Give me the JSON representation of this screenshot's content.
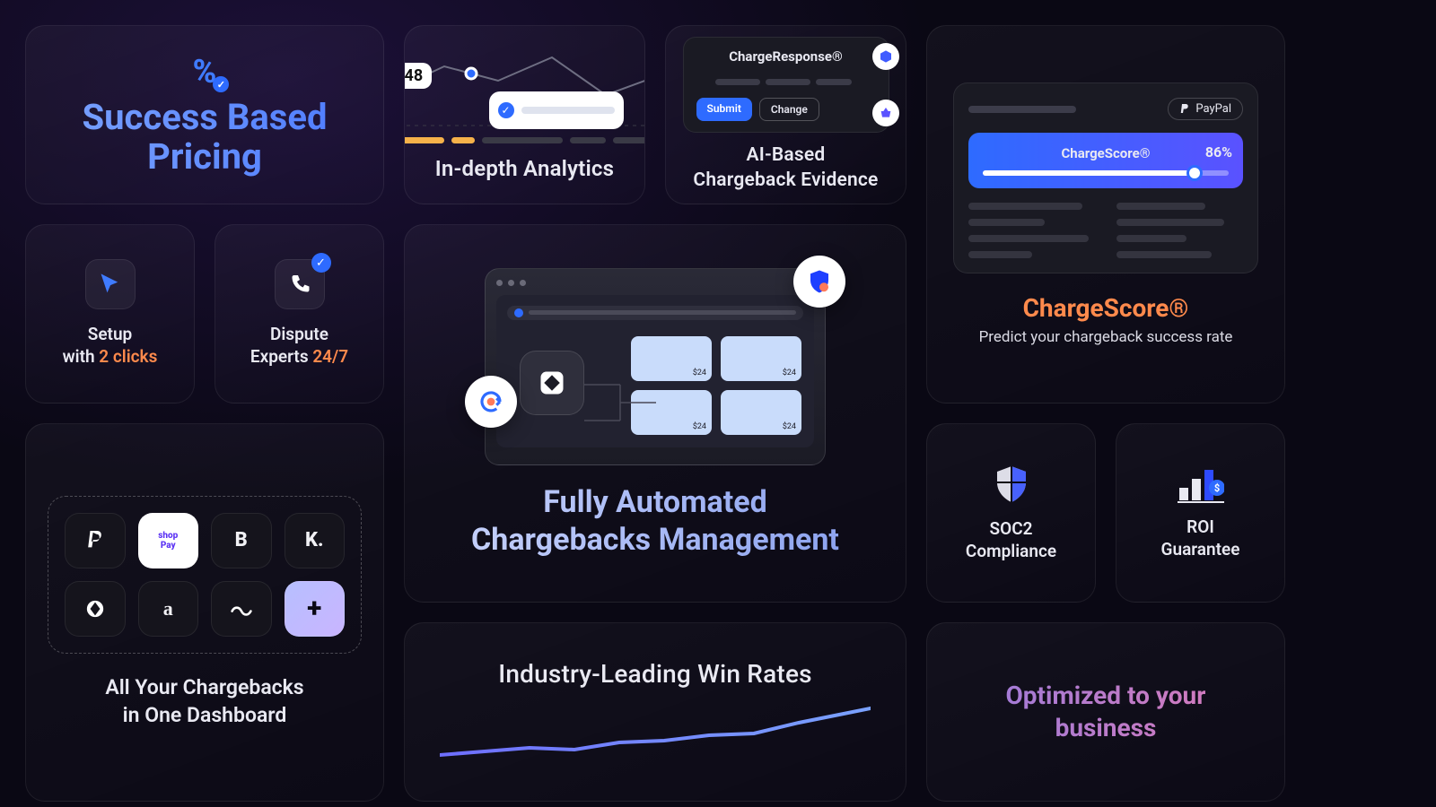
{
  "pricing": {
    "heading": "Success Based Pricing"
  },
  "setup": {
    "line1": "Setup",
    "line2_prefix": "with ",
    "line2_accent": "2 clicks"
  },
  "experts": {
    "line1": "Dispute",
    "line2_prefix": "Experts ",
    "line2_accent": "24/7"
  },
  "integrations": {
    "tiles": [
      "P",
      "shop",
      "B",
      "K.",
      "◔",
      "a",
      "⇄",
      "+"
    ],
    "caption_l1": "All Your Chargebacks",
    "caption_l2": "in One Dashboard"
  },
  "analytics": {
    "badge": "48",
    "title": "In-depth Analytics"
  },
  "evidence": {
    "panel_title": "ChargeResponse®",
    "submit": "Submit",
    "change": "Change",
    "title_l1": "AI-Based",
    "title_l2": "Chargeback Evidence"
  },
  "automated": {
    "title_l1": "Fully Automated",
    "title_l2": "Chargebacks Management",
    "card_amount": "$24"
  },
  "winrates": {
    "title": "Industry-Leading Win Rates"
  },
  "score": {
    "paypal": "PayPal",
    "gauge_label": "ChargeScore®",
    "percent": "86%",
    "heading": "ChargeScore®",
    "sub": "Predict your chargeback success rate"
  },
  "soc2": {
    "l1": "SOC2",
    "l2": "Compliance"
  },
  "roi": {
    "l1": "ROI",
    "l2": "Guarantee"
  },
  "optimized": {
    "l1": "Optimized to your",
    "l2": "business"
  }
}
